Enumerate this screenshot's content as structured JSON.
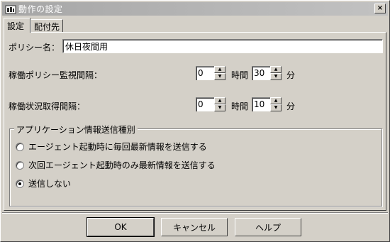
{
  "window": {
    "title": "動作の設定",
    "close_symbol": "×"
  },
  "tabs": [
    {
      "label": "設定",
      "active": true
    },
    {
      "label": "配付先",
      "active": false
    }
  ],
  "policy": {
    "label": "ポリシー名：",
    "value": "休日夜間用"
  },
  "monitor_interval": {
    "label": "稼働ポリシー監視間隔：",
    "hours_value": "0",
    "hours_unit": "時間",
    "minutes_value": "30",
    "minutes_unit": "分"
  },
  "status_interval": {
    "label": "稼働状況取得間隔：",
    "hours_value": "0",
    "hours_unit": "時間",
    "minutes_value": "10",
    "minutes_unit": "分"
  },
  "send_group": {
    "title": "アプリケーション情報送信種別",
    "options": [
      {
        "label": "エージェント起動時に毎回最新情報を送信する",
        "checked": false
      },
      {
        "label": "次回エージェント起動時のみ最新情報を送信する",
        "checked": false
      },
      {
        "label": "送信しない",
        "checked": true
      }
    ]
  },
  "buttons": {
    "ok": "OK",
    "cancel": "キャンセル",
    "help": "ヘルプ"
  },
  "icons": {
    "spin_up": "▲",
    "spin_down": "▼"
  }
}
